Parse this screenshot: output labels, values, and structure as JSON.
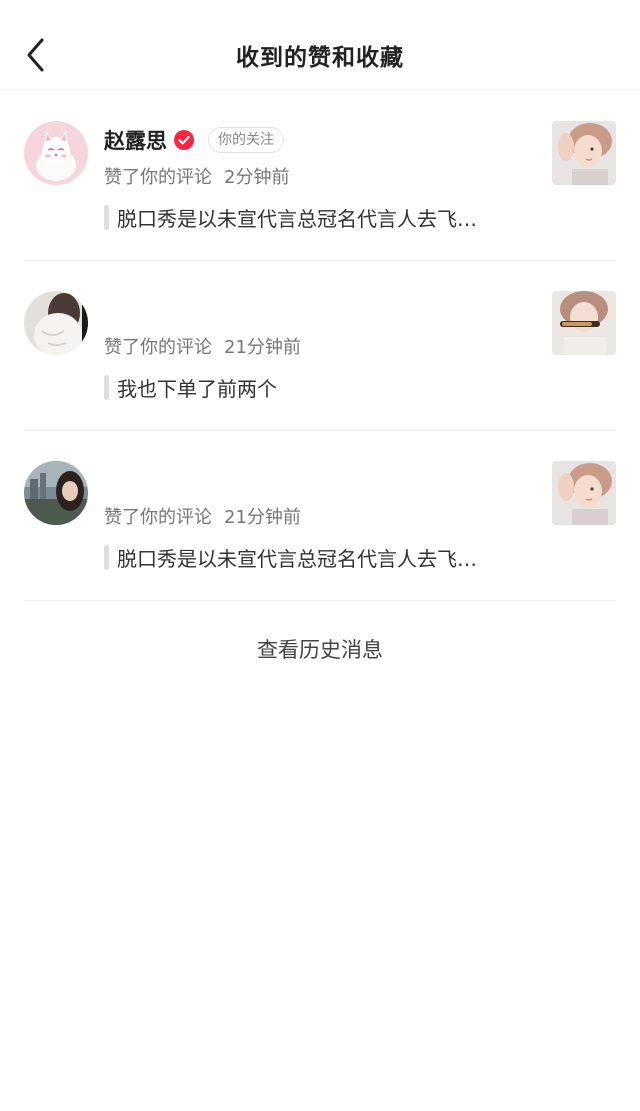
{
  "header": {
    "title": "收到的赞和收藏"
  },
  "notifications": [
    {
      "user_name": "赵露思",
      "verified": true,
      "tag": "你的关注",
      "action": "赞了你的评论",
      "time": "2分钟前",
      "comment": "脱口秀是以未宣代言总冠名代言人去飞…"
    },
    {
      "user_name": "",
      "verified": false,
      "tag": "",
      "action": "赞了你的评论",
      "time": "21分钟前",
      "comment": "我也下单了前两个"
    },
    {
      "user_name": "",
      "verified": false,
      "tag": "",
      "action": "赞了你的评论",
      "time": "21分钟前",
      "comment": "脱口秀是以未宣代言总冠名代言人去飞…"
    }
  ],
  "footer": {
    "history_label": "查看历史消息"
  },
  "colors": {
    "verified_badge": "#ff2442",
    "divider": "#eeeeee",
    "quote_bar": "#dedede"
  },
  "icons": {
    "back": "back-arrow-icon",
    "verified": "verified-check-icon"
  }
}
